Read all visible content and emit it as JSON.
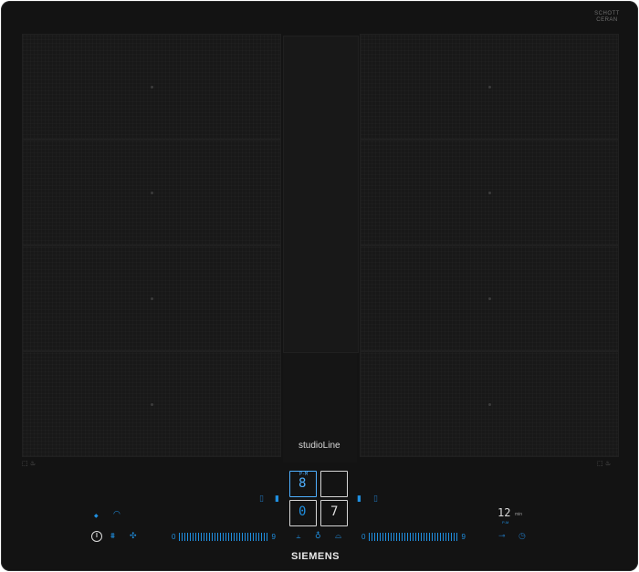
{
  "brand": {
    "top_model": "",
    "glass_brand": "SCHOTT CERAN",
    "glass_sub": "",
    "series": "studioLine",
    "manufacturer": "SIEMENS"
  },
  "zones": {
    "left_icons": "⬚ ♨",
    "right_icons": "⬚ ♨"
  },
  "display": {
    "left_top_label": "P-M",
    "left_top_digit": "8",
    "left_bottom_digit": "0",
    "right_bottom_digit": "7",
    "timer_value": "12",
    "timer_unit": "min",
    "timer_sub": "P-M"
  },
  "sliders": {
    "left_start": "0",
    "left_end": "9",
    "right_start": "0",
    "right_end": "9"
  },
  "controls": {
    "power_symbol": "I"
  },
  "colors": {
    "accent": "#1f8fe0",
    "glass": "#131313"
  }
}
